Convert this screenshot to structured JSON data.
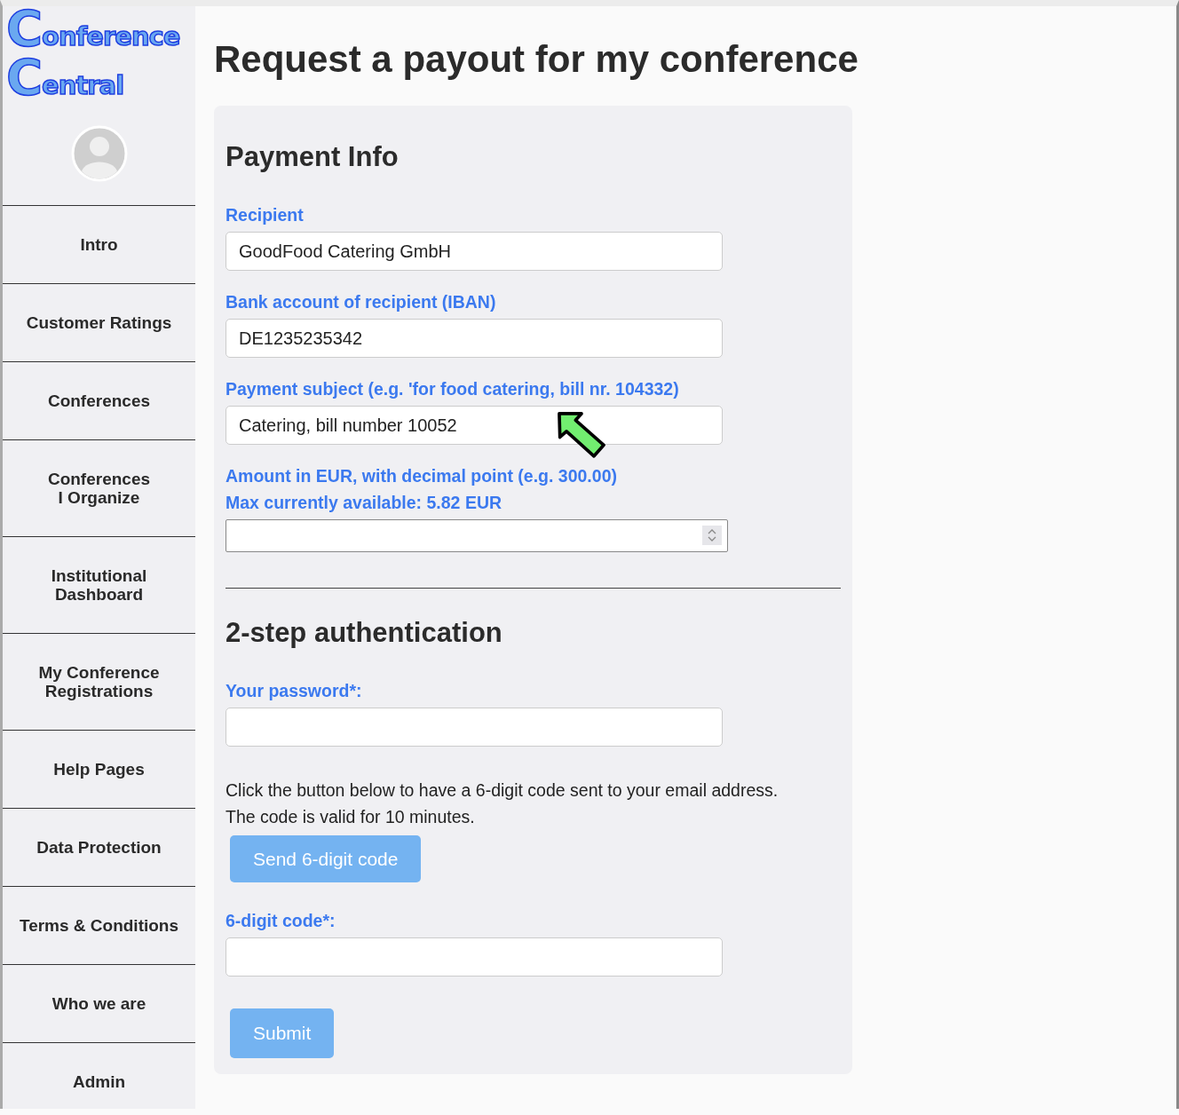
{
  "logo": {
    "lines": [
      "Conference",
      "Central"
    ]
  },
  "sidebar": {
    "items": [
      {
        "label": "Intro"
      },
      {
        "label": "Customer Ratings"
      },
      {
        "label": "Conferences"
      },
      {
        "label": "Conferences\nI Organize"
      },
      {
        "label": "Institutional\nDashboard"
      },
      {
        "label": "My Conference\nRegistrations"
      },
      {
        "label": "Help Pages"
      },
      {
        "label": "Data Protection"
      },
      {
        "label": "Terms & Conditions"
      },
      {
        "label": "Who we are"
      },
      {
        "label": "Admin"
      }
    ]
  },
  "page_title": "Request a payout for my conference",
  "payment_info": {
    "heading": "Payment Info",
    "fields": [
      {
        "kind": "text",
        "labels": [
          "Recipient"
        ],
        "value": "GoodFood Catering GmbH"
      },
      {
        "kind": "text",
        "labels": [
          "Bank account of recipient (IBAN)"
        ],
        "value": "DE1235235342"
      },
      {
        "kind": "text",
        "labels": [
          "Payment subject (e.g. 'for food catering, bill nr. 104332)"
        ],
        "value": "Catering, bill number 10052"
      },
      {
        "kind": "number",
        "labels": [
          "Amount in EUR, with decimal point (e.g. 300.00)",
          "Max currently available: 5.82 EUR"
        ]
      }
    ]
  },
  "authentication": {
    "heading": "2-step authentication",
    "password_label": "Your password*:",
    "info_lines": [
      "Click the button below to have a 6-digit code sent to your email address.",
      "The code is valid for 10 minutes."
    ],
    "send_button": "Send 6-digit code",
    "code_label": "6-digit code*:",
    "submit_button": "Submit"
  }
}
